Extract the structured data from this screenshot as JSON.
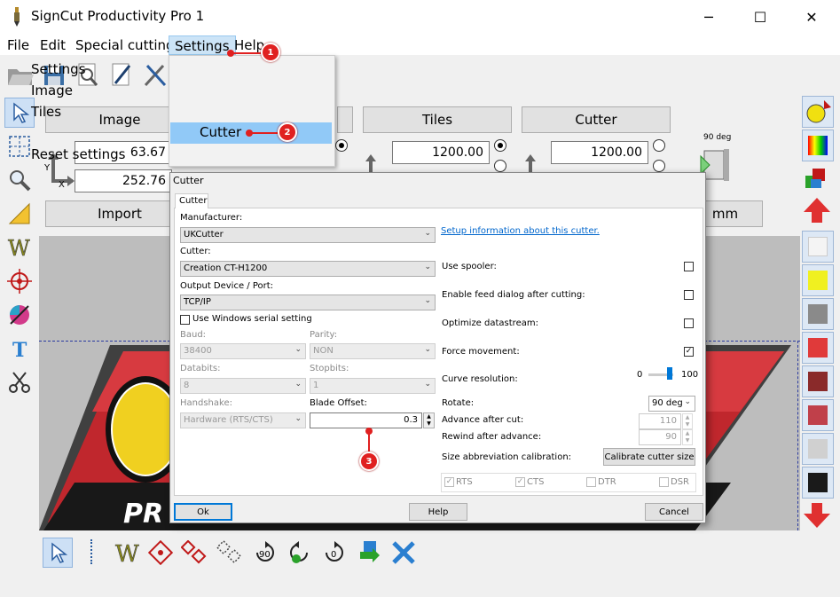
{
  "window": {
    "title": "SignCut Productivity Pro 1",
    "minimize": "─",
    "maximize": "☐",
    "close": "✕"
  },
  "menu": [
    "File",
    "Edit",
    "Special cutting",
    "Settings",
    "Help"
  ],
  "settings_menu": [
    "Settings",
    "Image",
    "Tiles",
    "Cutter",
    "Reset settings"
  ],
  "panels": {
    "image": {
      "label": "Image",
      "x": "63.67",
      "y": "252.76",
      "x_axis": "X",
      "y_axis": "Y",
      "import": "Import"
    },
    "tiles": {
      "label": "Tiles",
      "value": "1200.00"
    },
    "cutter": {
      "label": "Cutter",
      "value": "1200.00",
      "rotation": "90 deg",
      "unit": "mm"
    }
  },
  "callouts": [
    "1",
    "2",
    "3"
  ],
  "dialog": {
    "title": "Cutter",
    "tab": "Cutter",
    "manufacturer_label": "Manufacturer:",
    "manufacturer": "UKCutter",
    "setup_link": "Setup information about this cutter.",
    "cutter_label": "Cutter:",
    "cutter": "Creation CT-H1200",
    "port_label": "Output Device / Port:",
    "port": "TCP/IP",
    "win_serial": "Use Windows serial setting",
    "baud_label": "Baud:",
    "baud": "38400",
    "parity_label": "Parity:",
    "parity": "NON",
    "databits_label": "Databits:",
    "databits": "8",
    "stopbits_label": "Stopbits:",
    "stopbits": "1",
    "handshake_label": "Handshake:",
    "handshake": "Hardware (RTS/CTS)",
    "blade_label": "Blade Offset:",
    "blade": "0.3",
    "use_spooler": "Use spooler:",
    "feed_dialog": "Enable feed dialog after cutting:",
    "optimize": "Optimize datastream:",
    "force": "Force movement:",
    "curve_label": "Curve resolution:",
    "curve_min": "0",
    "curve_max": "100",
    "rotate_label": "Rotate:",
    "rotate": "90 deg",
    "advance_label": "Advance after cut:",
    "advance": "110",
    "rewind_label": "Rewind after advance:",
    "rewind": "90",
    "size_cal_label": "Size abbreviation calibration:",
    "calibrate_btn": "Calibrate cutter size",
    "rts": "RTS",
    "cts": "CTS",
    "dtr": "DTR",
    "dsr": "DSR",
    "ok": "Ok",
    "help": "Help",
    "cancel": "Cancel"
  }
}
